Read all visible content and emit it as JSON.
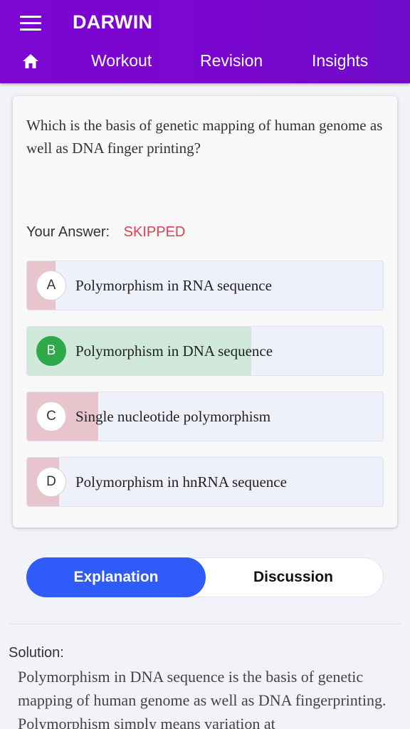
{
  "app": {
    "title": "DARWIN"
  },
  "nav": {
    "home_icon": "home-icon",
    "tabs": [
      {
        "label": "Workout"
      },
      {
        "label": "Revision"
      },
      {
        "label": "Insights"
      }
    ]
  },
  "question": {
    "text": "Which is the basis of genetic mapping of human genome as well as DNA finger printing?",
    "your_answer_label": "Your Answer:",
    "your_answer_value": "SKIPPED"
  },
  "options": [
    {
      "letter": "A",
      "text": "Polymorphism in RNA sequence",
      "percent": 8,
      "correct": false
    },
    {
      "letter": "B",
      "text": "Polymorphism in DNA sequence",
      "percent": 63,
      "correct": true
    },
    {
      "letter": "C",
      "text": "Single nucleotide polymorphism",
      "percent": 20,
      "correct": false
    },
    {
      "letter": "D",
      "text": "Polymorphism in hnRNA sequence",
      "percent": 9,
      "correct": false
    }
  ],
  "toggle": {
    "explanation": "Explanation",
    "discussion": "Discussion",
    "selected": "Explanation"
  },
  "solution": {
    "label": "Solution:",
    "text": "Polymorphism in DNA sequence is the basis of genetic mapping of human genome as well as DNA fingerprinting. Polymorphism simply means variation at"
  },
  "colors": {
    "header": "#7a07cf",
    "skipped": "#e0404d",
    "correct": "#2fa84a",
    "active_tab": "#2f5cf8"
  }
}
